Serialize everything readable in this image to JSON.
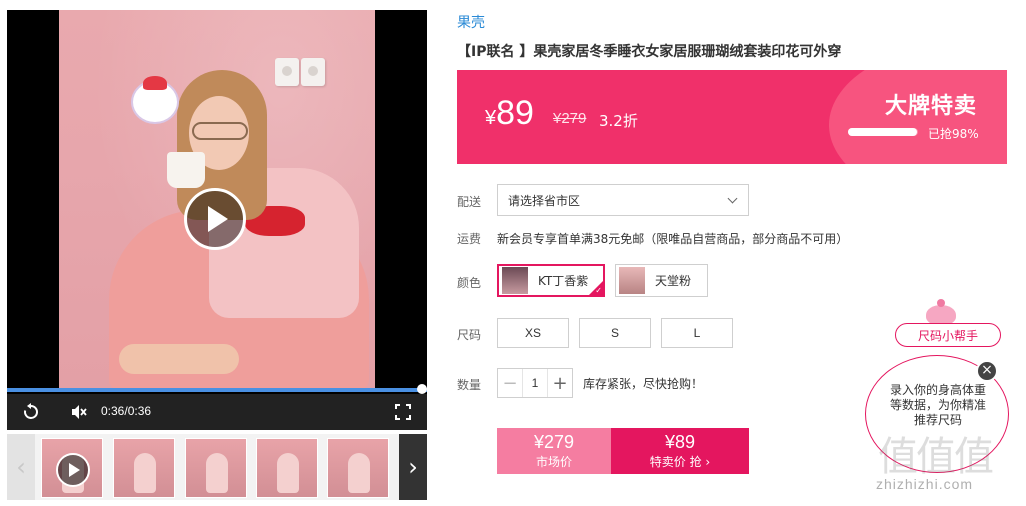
{
  "video": {
    "time": "0:36/0:36",
    "progress": 1.0,
    "icons": [
      "play-icon",
      "replay-icon",
      "mute-icon",
      "fullscreen-icon"
    ]
  },
  "thumbnails": {
    "count": 6,
    "icons": [
      "chevron-left-icon",
      "chevron-right-icon"
    ]
  },
  "product": {
    "brand": "果壳",
    "title": "【IP联名 】果壳家居冬季睡衣女家居服珊瑚绒套装印花可外穿"
  },
  "price": {
    "currency": "¥",
    "current": "89",
    "original": "¥279",
    "discount": "3.2折",
    "badge": "大牌特卖",
    "sold_text": "已抢98%",
    "sold_fraction": 0.98,
    "colors": {
      "banner": "#f0306a",
      "accent": "#e4165f",
      "link": "#2a8ad6"
    }
  },
  "shipping": {
    "to_label": "配送",
    "region_placeholder": "请选择省市区",
    "fee_label": "运费",
    "fee_text": "新会员专享首单满38元免邮（限唯品自营商品，部分商品不可用）"
  },
  "color": {
    "label": "颜色",
    "options": [
      {
        "name": "KT丁香紫",
        "selected": true
      },
      {
        "name": "天堂粉",
        "selected": false
      }
    ]
  },
  "size": {
    "label": "尺码",
    "options": [
      "XS",
      "S",
      "L"
    ]
  },
  "quantity": {
    "label": "数量",
    "minus": "−",
    "value": "1",
    "plus": "+",
    "stock_text": "库存紧张，尽快抢购！"
  },
  "buy": {
    "market_price": "¥279",
    "market_label": "市场价",
    "special_price": "¥89",
    "special_label": "特卖价 抢 ›"
  },
  "size_helper": {
    "title": "尺码小帮手",
    "bubble": "录入你的身高体重等数据，为你精准推荐尺码",
    "close": "×"
  },
  "watermark": {
    "glyphs": "值值值",
    "text": "zhizhizhi.com"
  }
}
